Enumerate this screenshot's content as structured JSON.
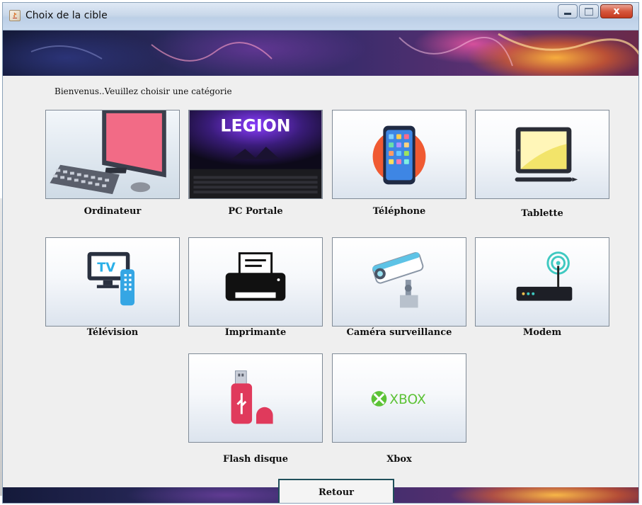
{
  "window": {
    "title": "Choix de la cible",
    "close_glyph": "x"
  },
  "main": {
    "welcome_text": "Bienvenus..Veuillez choisir une catégorie"
  },
  "categories": [
    {
      "label": "Ordinateur",
      "icon": "desktop-computer-icon"
    },
    {
      "label": "PC Portale",
      "icon": "legion-laptop-image",
      "image_text": "LEGION"
    },
    {
      "label": "Téléphone",
      "icon": "smartphone-icon"
    },
    {
      "label": "Tablette",
      "icon": "tablet-icon"
    },
    {
      "label": "Télévision",
      "icon": "tv-remote-icon",
      "image_text": "TV"
    },
    {
      "label": "Imprimante",
      "icon": "printer-icon"
    },
    {
      "label": "Caméra surveillance",
      "icon": "security-camera-icon"
    },
    {
      "label": "Modem",
      "icon": "router-icon"
    },
    {
      "label": "Flash disque",
      "icon": "usb-flash-drive-icon"
    },
    {
      "label": "Xbox",
      "icon": "xbox-logo",
      "image_text": "XBOX"
    }
  ],
  "footer": {
    "back_label": "Retour"
  }
}
